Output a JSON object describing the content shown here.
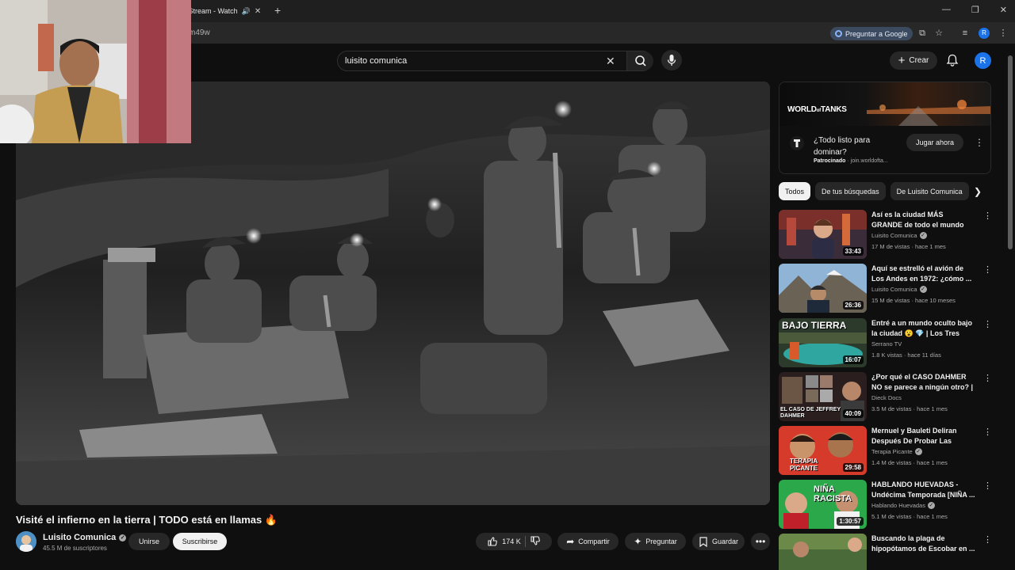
{
  "browser": {
    "tab_title": "n Stream - Watch",
    "url": "m49w",
    "ask_google_label": "Preguntar a Google",
    "profile_initial": "R"
  },
  "header": {
    "search_value": "luisito comunica",
    "create_label": "Crear",
    "avatar_initial": "R"
  },
  "video": {
    "title": "Visité el infierno en la tierra | TODO está en llamas 🔥",
    "channel": "Luisito Comunica",
    "subscribers": "45.5 M de suscriptores",
    "join_label": "Unirse",
    "subscribe_label": "Suscribirse",
    "likes": "174 K",
    "share_label": "Compartir",
    "ask_label": "Preguntar",
    "save_label": "Guardar"
  },
  "ad": {
    "logo": "WORLD",
    "logo_small": "of",
    "logo_end": "TANKS",
    "headline": "¿Todo listo para dominar?",
    "sponsored": "Patrocinado",
    "domain": "· join.worldofta...",
    "cta": "Jugar ahora"
  },
  "chips": [
    "Todos",
    "De tus búsquedas",
    "De Luisito Comunica"
  ],
  "recommendations": [
    {
      "title": "Así es la ciudad MÁS GRANDE de todo el mundo (impactante...",
      "channel": "Luisito Comunica",
      "verified": true,
      "meta": "17 M de vistas · hace 1 mes",
      "duration": "33:43",
      "thumb_text": ""
    },
    {
      "title": "Aquí se estrelló el avión de Los Andes en 1972: ¿cómo ...",
      "channel": "Luisito Comunica",
      "verified": true,
      "meta": "15 M de vistas · hace 10 meses",
      "duration": "26:36",
      "thumb_text": ""
    },
    {
      "title": "Entré a un mundo oculto bajo la ciudad 😮 💎 | Los Tres Ojos, ...",
      "channel": "Serrano TV",
      "verified": false,
      "meta": "1.8 K vistas · hace 11 días",
      "duration": "16:07",
      "thumb_text": "BAJO TIERRA"
    },
    {
      "title": "¿Por qué el CASO DAHMER NO se parece a ningún otro? | ...",
      "channel": "Dieck Docs",
      "verified": false,
      "meta": "3.5 M de vistas · hace 1 mes",
      "duration": "40:09",
      "thumb_text": "EL CASO DE JEFFREY DAHMER"
    },
    {
      "title": "Mernuel y Bauleti Deliran Después De Probar Las Salsas...",
      "channel": "Terapia Picante",
      "verified": true,
      "meta": "1.4 M de vistas · hace 1 mes",
      "duration": "29:58",
      "thumb_text": "TERAPIA PICANTE"
    },
    {
      "title": "HABLANDO HUEVADAS - Undécima Temporada [NIÑA ...",
      "channel": "Hablando Huevadas",
      "verified": true,
      "meta": "5.1 M de vistas · hace 1 mes",
      "duration": "1:30:57",
      "thumb_text": "NIÑA RACISTA"
    },
    {
      "title": "Buscando la plaga de hipopótamos de Escobar en ...",
      "channel": "",
      "verified": false,
      "meta": "",
      "duration": "",
      "thumb_text": ""
    }
  ]
}
